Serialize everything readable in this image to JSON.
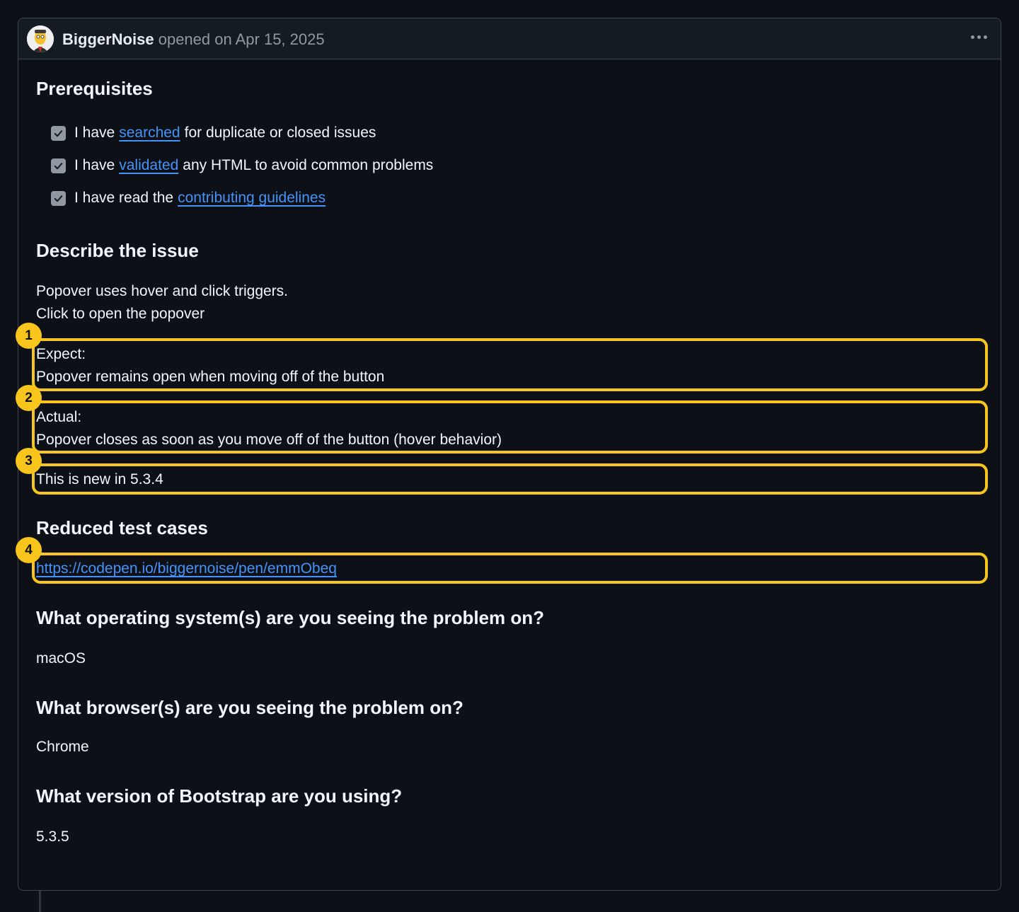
{
  "issue": {
    "author": "BiggerNoise",
    "meta": "opened on Apr 15, 2025"
  },
  "prerequisites": {
    "heading": "Prerequisites",
    "items": [
      {
        "before": "I have",
        "link": "searched",
        "after": "for duplicate or closed issues",
        "checked": true
      },
      {
        "before": "I have",
        "link": "validated",
        "after": "any HTML to avoid common problems",
        "checked": true
      },
      {
        "before": "I have read the",
        "link": "contributing guidelines",
        "after": "",
        "checked": true
      }
    ]
  },
  "describe": {
    "heading": "Describe the issue",
    "line1": "Popover uses hover and click triggers.",
    "line2": "Click to open the popover",
    "expect_label": "Expect:",
    "expect_text": "Popover remains open when moving off of the button",
    "actual_label": "Actual:",
    "actual_text": "Popover closes as soon as you move off of the button (hover behavior)",
    "new_in": "This is new in 5.3.4"
  },
  "reduced": {
    "heading": "Reduced test cases",
    "url": "https://codepen.io/biggernoise/pen/emmObeq"
  },
  "os": {
    "heading": "What operating system(s) are you seeing the problem on?",
    "value": "macOS"
  },
  "browser": {
    "heading": "What browser(s) are you seeing the problem on?",
    "value": "Chrome"
  },
  "version": {
    "heading": "What version of Bootstrap are you using?",
    "value": "5.3.5"
  },
  "annotations": [
    "1",
    "2",
    "3",
    "4"
  ],
  "colors": {
    "highlight": "#f8c51c",
    "link": "#4493f8",
    "background": "#0d1117"
  }
}
